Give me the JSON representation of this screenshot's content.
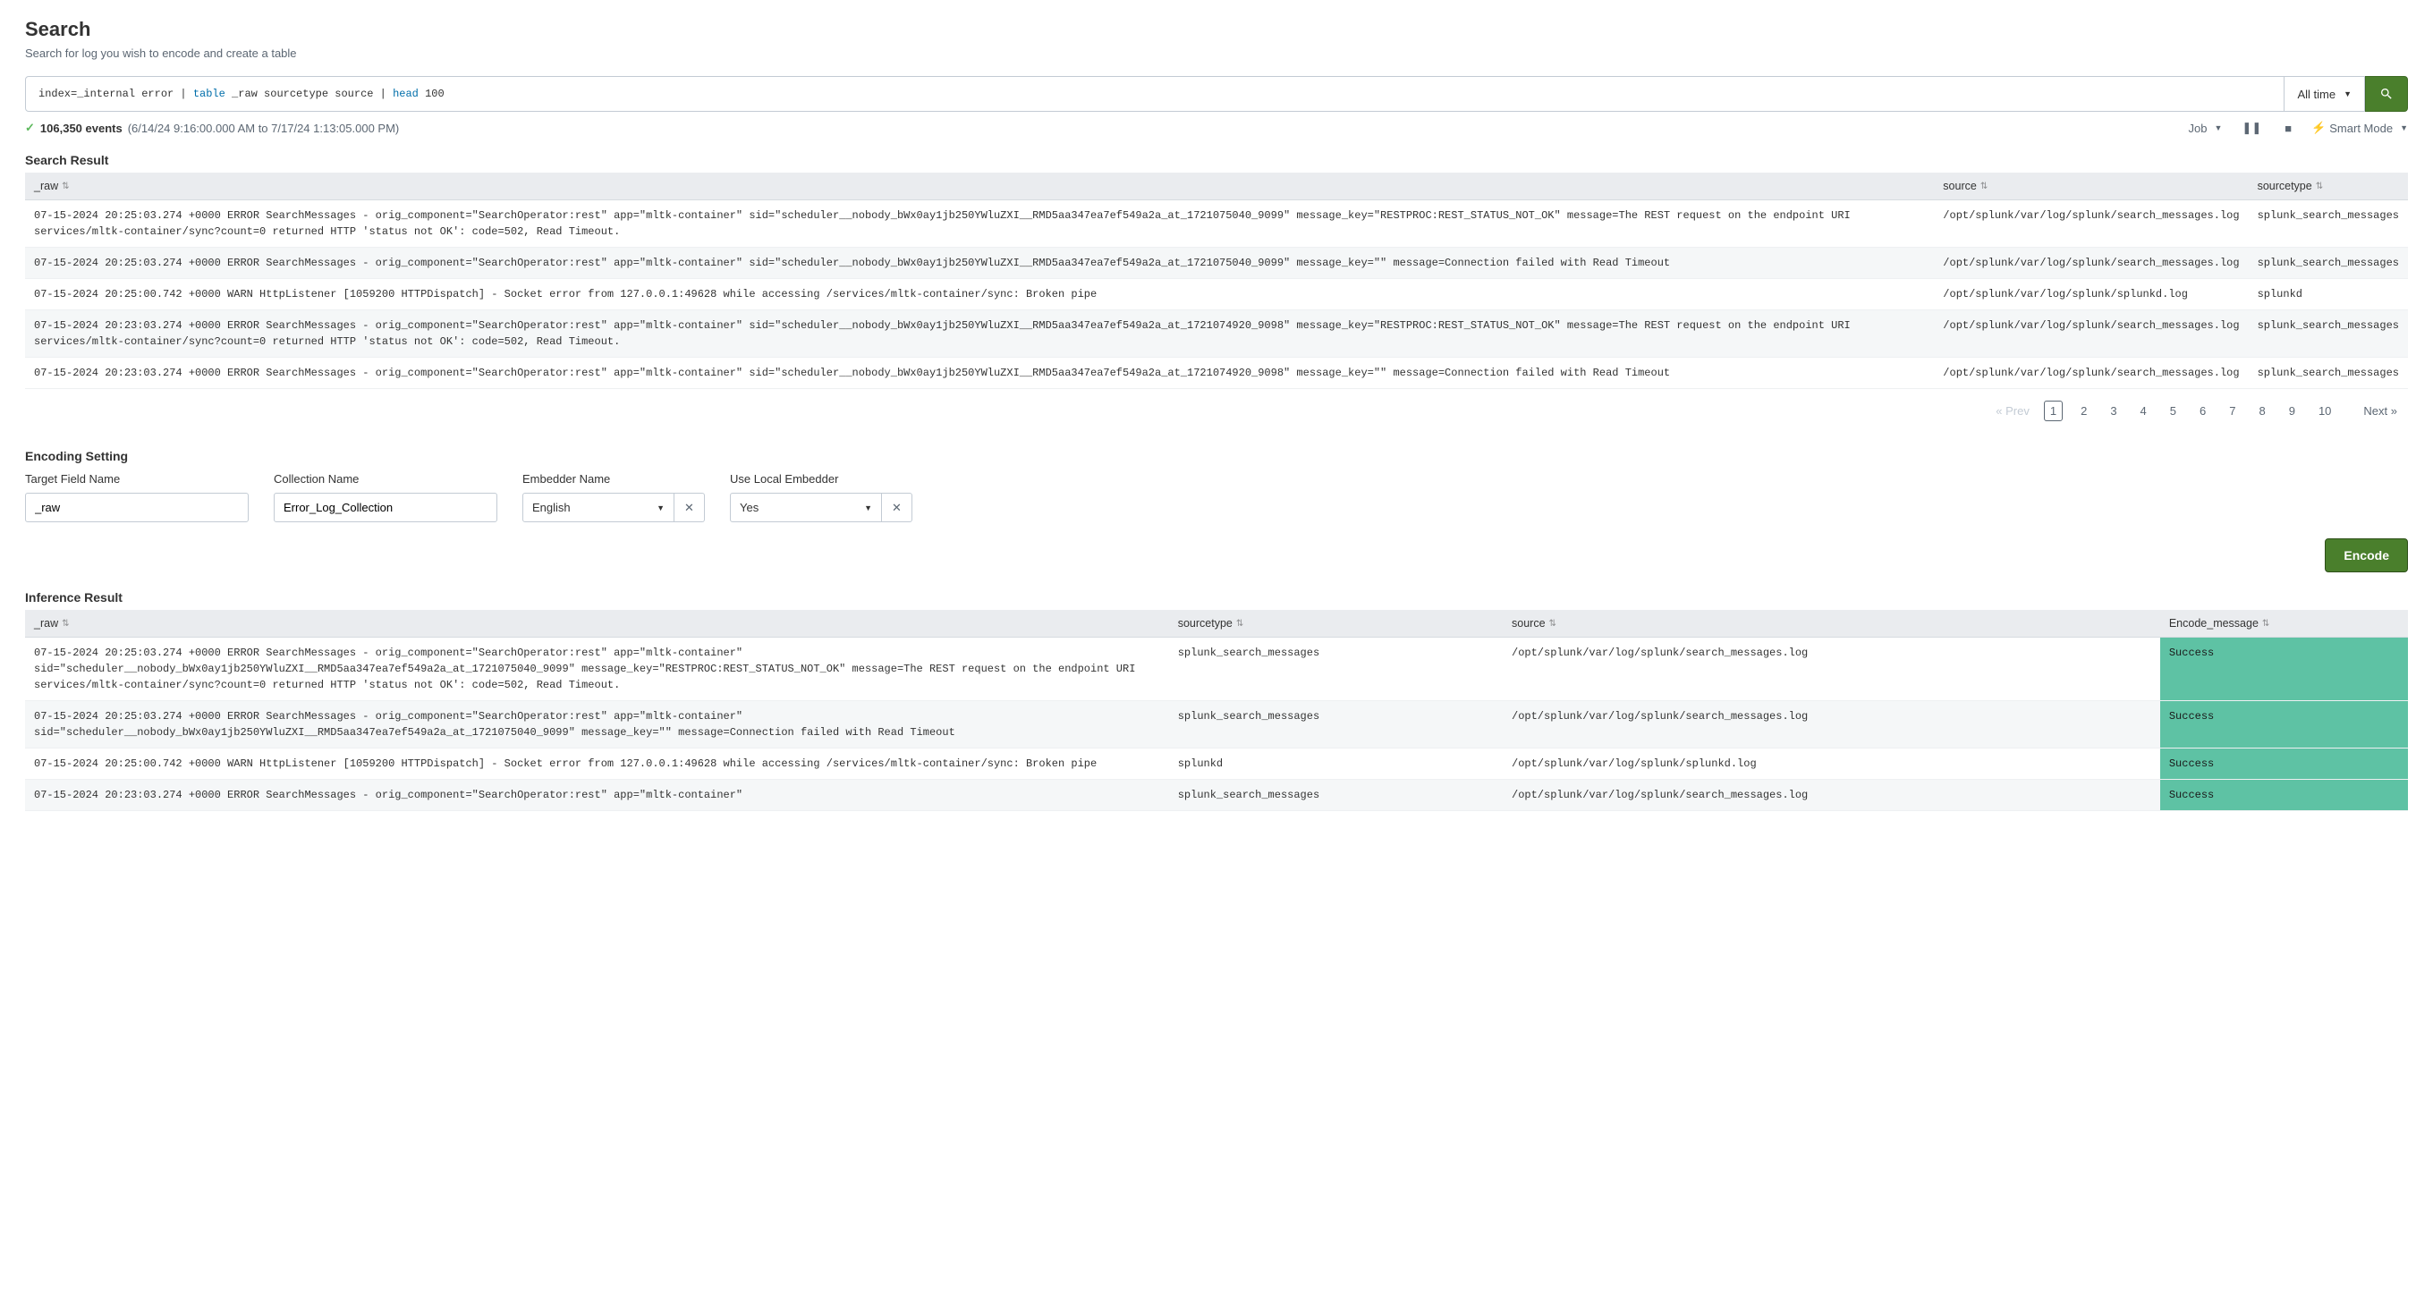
{
  "header": {
    "title": "Search",
    "subtitle": "Search for log you wish to encode and create a table"
  },
  "search": {
    "query_pre": "index=_internal error | ",
    "query_kw1": "table",
    "query_mid": " _raw sourcetype source | ",
    "query_kw2": "head",
    "query_post": " 100",
    "time_label": "All time"
  },
  "status": {
    "events": "106,350 events",
    "range": "(6/14/24 9:16:00.000 AM to 7/17/24 1:13:05.000 PM)",
    "job_label": "Job",
    "smart_mode": "Smart Mode"
  },
  "search_result": {
    "title": "Search Result",
    "columns": {
      "raw": "_raw",
      "source": "source",
      "sourcetype": "sourcetype"
    },
    "rows": [
      {
        "raw": "07-15-2024 20:25:03.274 +0000 ERROR SearchMessages - orig_component=\"SearchOperator:rest\" app=\"mltk-container\" sid=\"scheduler__nobody_bWx0ay1jb250YWluZXI__RMD5aa347ea7ef549a2a_at_1721075040_9099\" message_key=\"RESTPROC:REST_STATUS_NOT_OK\" message=The REST request on the endpoint URI services/mltk-container/sync?count=0 returned HTTP 'status not OK': code=502, Read Timeout.",
        "source": "/opt/splunk/var/log/splunk/search_messages.log",
        "sourcetype": "splunk_search_messages"
      },
      {
        "raw": "07-15-2024 20:25:03.274 +0000 ERROR SearchMessages - orig_component=\"SearchOperator:rest\" app=\"mltk-container\" sid=\"scheduler__nobody_bWx0ay1jb250YWluZXI__RMD5aa347ea7ef549a2a_at_1721075040_9099\" message_key=\"\" message=Connection failed with Read Timeout",
        "source": "/opt/splunk/var/log/splunk/search_messages.log",
        "sourcetype": "splunk_search_messages"
      },
      {
        "raw": "07-15-2024 20:25:00.742 +0000 WARN  HttpListener [1059200 HTTPDispatch] - Socket error from 127.0.0.1:49628 while accessing /services/mltk-container/sync: Broken pipe",
        "source": "/opt/splunk/var/log/splunk/splunkd.log",
        "sourcetype": "splunkd"
      },
      {
        "raw": "07-15-2024 20:23:03.274 +0000 ERROR SearchMessages - orig_component=\"SearchOperator:rest\" app=\"mltk-container\" sid=\"scheduler__nobody_bWx0ay1jb250YWluZXI__RMD5aa347ea7ef549a2a_at_1721074920_9098\" message_key=\"RESTPROC:REST_STATUS_NOT_OK\" message=The REST request on the endpoint URI services/mltk-container/sync?count=0 returned HTTP 'status not OK': code=502, Read Timeout.",
        "source": "/opt/splunk/var/log/splunk/search_messages.log",
        "sourcetype": "splunk_search_messages"
      },
      {
        "raw": "07-15-2024 20:23:03.274 +0000 ERROR SearchMessages - orig_component=\"SearchOperator:rest\" app=\"mltk-container\" sid=\"scheduler__nobody_bWx0ay1jb250YWluZXI__RMD5aa347ea7ef549a2a_at_1721074920_9098\" message_key=\"\" message=Connection failed with Read Timeout",
        "source": "/opt/splunk/var/log/splunk/search_messages.log",
        "sourcetype": "splunk_search_messages"
      }
    ]
  },
  "pagination": {
    "prev": "« Prev",
    "pages": [
      "1",
      "2",
      "3",
      "4",
      "5",
      "6",
      "7",
      "8",
      "9",
      "10"
    ],
    "next": "Next »",
    "active": "1"
  },
  "encoding": {
    "title": "Encoding Setting",
    "target_label": "Target Field Name",
    "target_value": "_raw",
    "collection_label": "Collection Name",
    "collection_value": "Error_Log_Collection",
    "embedder_label": "Embedder Name",
    "embedder_value": "English",
    "local_label": "Use Local Embedder",
    "local_value": "Yes",
    "encode_btn": "Encode"
  },
  "inference": {
    "title": "Inference Result",
    "columns": {
      "raw": "_raw",
      "sourcetype": "sourcetype",
      "source": "source",
      "encode": "Encode_message"
    },
    "rows": [
      {
        "raw": "07-15-2024 20:25:03.274 +0000 ERROR SearchMessages - orig_component=\"SearchOperator:rest\" app=\"mltk-container\" sid=\"scheduler__nobody_bWx0ay1jb250YWluZXI__RMD5aa347ea7ef549a2a_at_1721075040_9099\" message_key=\"RESTPROC:REST_STATUS_NOT_OK\" message=The REST request on the endpoint URI services/mltk-container/sync?count=0 returned HTTP 'status not OK': code=502, Read Timeout.",
        "sourcetype": "splunk_search_messages",
        "source": "/opt/splunk/var/log/splunk/search_messages.log",
        "encode": "Success"
      },
      {
        "raw": "07-15-2024 20:25:03.274 +0000 ERROR SearchMessages - orig_component=\"SearchOperator:rest\" app=\"mltk-container\" sid=\"scheduler__nobody_bWx0ay1jb250YWluZXI__RMD5aa347ea7ef549a2a_at_1721075040_9099\" message_key=\"\" message=Connection failed with Read Timeout",
        "sourcetype": "splunk_search_messages",
        "source": "/opt/splunk/var/log/splunk/search_messages.log",
        "encode": "Success"
      },
      {
        "raw": "07-15-2024 20:25:00.742 +0000 WARN  HttpListener [1059200 HTTPDispatch] - Socket error from 127.0.0.1:49628 while accessing /services/mltk-container/sync: Broken pipe",
        "sourcetype": "splunkd",
        "source": "/opt/splunk/var/log/splunk/splunkd.log",
        "encode": "Success"
      },
      {
        "raw": "07-15-2024 20:23:03.274 +0000 ERROR SearchMessages - orig_component=\"SearchOperator:rest\" app=\"mltk-container\"",
        "sourcetype": "splunk_search_messages",
        "source": "/opt/splunk/var/log/splunk/search_messages.log",
        "encode": "Success"
      }
    ]
  }
}
